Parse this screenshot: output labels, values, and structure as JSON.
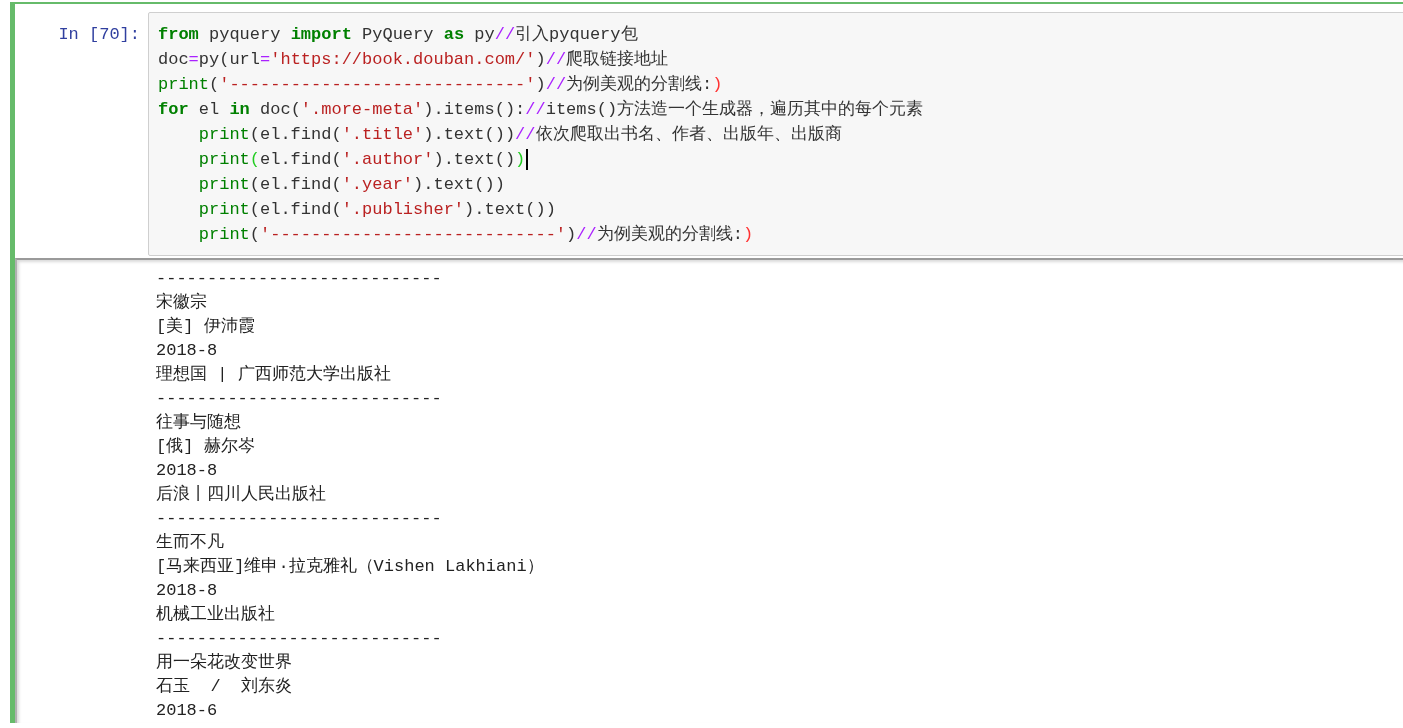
{
  "cell": {
    "prompt": "In [70]:",
    "code_lines": [
      [
        {
          "kind": "keyword",
          "text": "from"
        },
        {
          "kind": "plain",
          "text": " pyquery "
        },
        {
          "kind": "keyword",
          "text": "import"
        },
        {
          "kind": "plain",
          "text": " PyQuery "
        },
        {
          "kind": "keyword",
          "text": "as"
        },
        {
          "kind": "plain",
          "text": " py"
        },
        {
          "kind": "operator",
          "text": "//"
        },
        {
          "kind": "plain",
          "text": "引入pyquery包"
        }
      ],
      [
        {
          "kind": "plain",
          "text": "doc"
        },
        {
          "kind": "operator",
          "text": "="
        },
        {
          "kind": "plain",
          "text": "py(url"
        },
        {
          "kind": "operator",
          "text": "="
        },
        {
          "kind": "string",
          "text": "'https://book.douban.com/'"
        },
        {
          "kind": "plain",
          "text": ")"
        },
        {
          "kind": "operator",
          "text": "//"
        },
        {
          "kind": "plain",
          "text": "爬取链接地址"
        }
      ],
      [
        {
          "kind": "builtin",
          "text": "print"
        },
        {
          "kind": "plain",
          "text": "("
        },
        {
          "kind": "string",
          "text": "'-----------------------------'"
        },
        {
          "kind": "plain",
          "text": ")"
        },
        {
          "kind": "operator",
          "text": "//"
        },
        {
          "kind": "plain",
          "text": "为例美观的分割线:"
        },
        {
          "kind": "error",
          "text": ")"
        }
      ],
      [
        {
          "kind": "keyword",
          "text": "for"
        },
        {
          "kind": "plain",
          "text": " el "
        },
        {
          "kind": "keyword",
          "text": "in"
        },
        {
          "kind": "plain",
          "text": " doc("
        },
        {
          "kind": "string",
          "text": "'.more-meta'"
        },
        {
          "kind": "plain",
          "text": ").items():"
        },
        {
          "kind": "operator",
          "text": "//"
        },
        {
          "kind": "plain",
          "text": "items()方法造一个生成器，遍历其中的每个元素"
        }
      ],
      [
        {
          "kind": "indent"
        },
        {
          "kind": "builtin",
          "text": "print"
        },
        {
          "kind": "plain",
          "text": "(el.find("
        },
        {
          "kind": "string",
          "text": "'.title'"
        },
        {
          "kind": "plain",
          "text": ").text())"
        },
        {
          "kind": "operator",
          "text": "//"
        },
        {
          "kind": "plain",
          "text": "依次爬取出书名、作者、出版年、出版商"
        }
      ],
      [
        {
          "kind": "indent"
        },
        {
          "kind": "builtin",
          "text": "print"
        },
        {
          "kind": "match",
          "text": "("
        },
        {
          "kind": "plain",
          "text": "el.find("
        },
        {
          "kind": "string",
          "text": "'.author'"
        },
        {
          "kind": "plain",
          "text": ").text()"
        },
        {
          "kind": "match",
          "text": ")"
        },
        {
          "kind": "cursor"
        }
      ],
      [
        {
          "kind": "indent"
        },
        {
          "kind": "builtin",
          "text": "print"
        },
        {
          "kind": "plain",
          "text": "(el.find("
        },
        {
          "kind": "string",
          "text": "'.year'"
        },
        {
          "kind": "plain",
          "text": ").text())"
        }
      ],
      [
        {
          "kind": "indent"
        },
        {
          "kind": "builtin",
          "text": "print"
        },
        {
          "kind": "plain",
          "text": "(el.find("
        },
        {
          "kind": "string",
          "text": "'.publisher'"
        },
        {
          "kind": "plain",
          "text": ").text())"
        }
      ],
      [
        {
          "kind": "indent"
        },
        {
          "kind": "builtin",
          "text": "print"
        },
        {
          "kind": "plain",
          "text": "("
        },
        {
          "kind": "string",
          "text": "'----------------------------'"
        },
        {
          "kind": "plain",
          "text": ")"
        },
        {
          "kind": "operator",
          "text": "//"
        },
        {
          "kind": "plain",
          "text": "为例美观的分割线:"
        },
        {
          "kind": "error",
          "text": ")"
        }
      ]
    ],
    "output_lines": [
      "----------------------------",
      "宋徽宗",
      "[美] 伊沛霞",
      "2018-8",
      "理想国 | 广西师范大学出版社",
      "----------------------------",
      "往事与随想",
      "[俄] 赫尔岑",
      "2018-8",
      "后浪丨四川人民出版社",
      "----------------------------",
      "生而不凡",
      "[马来西亚]维申·拉克雅礼（Vishen Lakhiani）",
      "2018-8",
      "机械工业出版社",
      "----------------------------",
      "用一朵花改变世界",
      "石玉  /  刘东炎",
      "2018-6"
    ]
  }
}
